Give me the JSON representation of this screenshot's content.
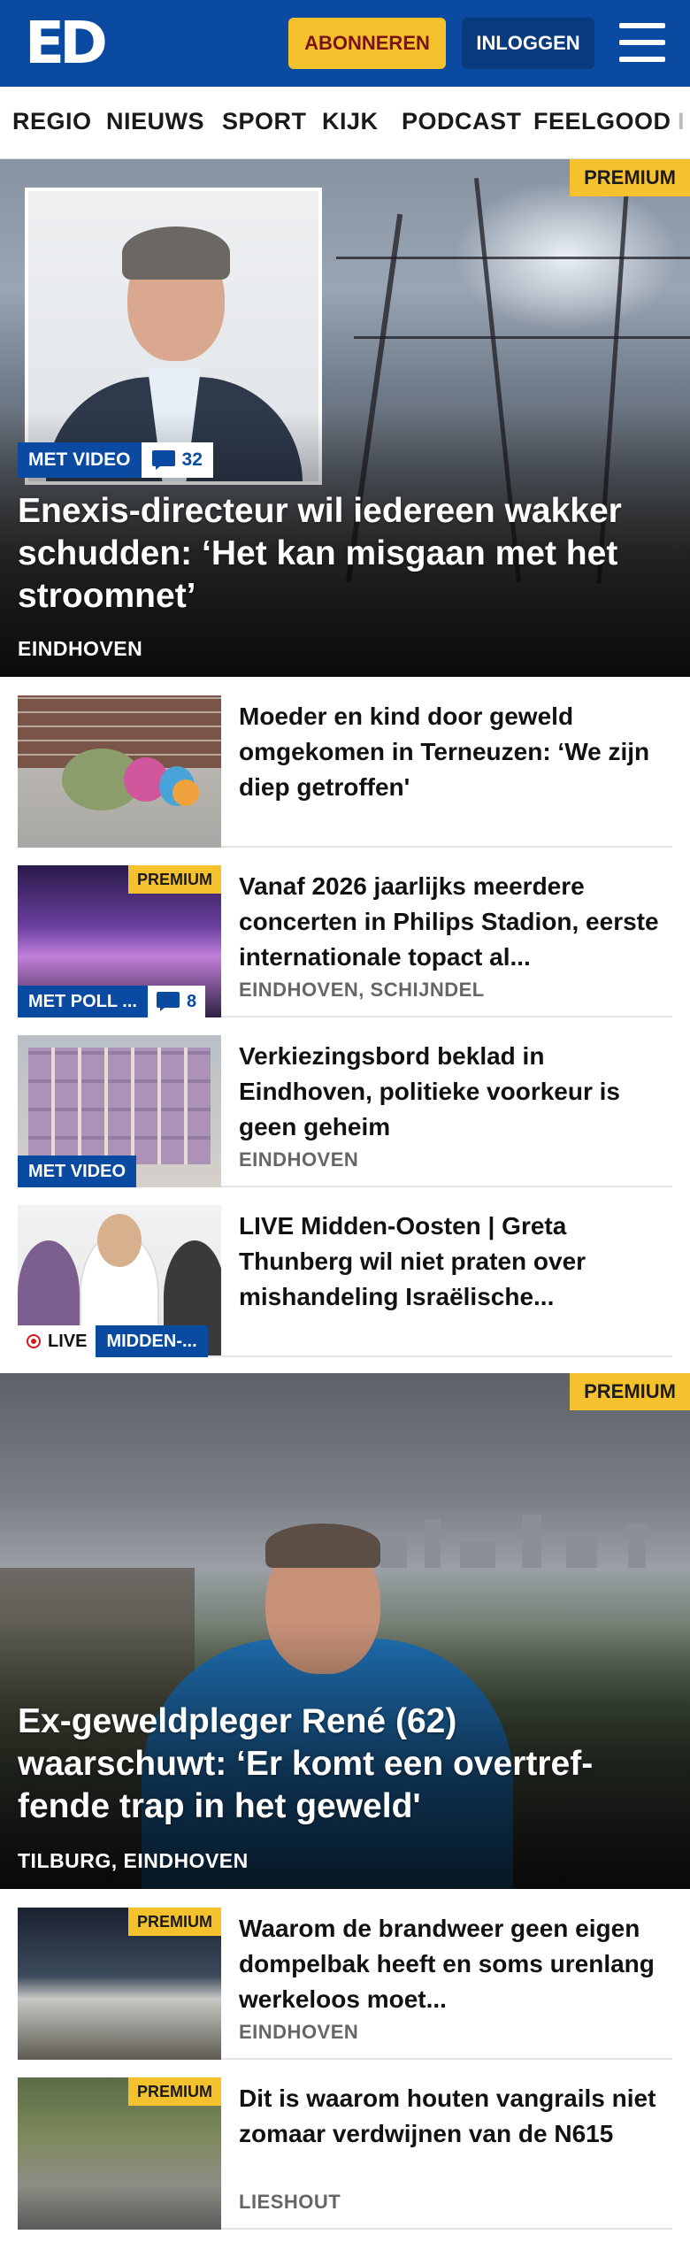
{
  "header": {
    "logo_text": "ED",
    "subscribe_label": "ABONNEREN",
    "login_label": "INLOGGEN",
    "brand_color": "#0a4ba1",
    "accent_color": "#f5c22e"
  },
  "nav": {
    "items": [
      "REGIO",
      "NIEUWS",
      "SPORT",
      "KIJK",
      "PODCAST",
      "FEELGOOD",
      "I"
    ]
  },
  "hero1": {
    "premium_label": "PREMIUM",
    "video_label": "MET VIDEO",
    "comment_count": "32",
    "title": "Enexis-directeur wil iedereen wakker schudden: ‘Het kan misgaan met het stroomnet’",
    "location": "EINDHOVEN"
  },
  "articles": [
    {
      "title": "Moeder en kind door geweld omgekomen in Terneuzen: ‘We zijn diep getroffen'",
      "location": ""
    },
    {
      "premium_label": "PREMIUM",
      "badge_label": "MET POLL ...",
      "comment_count": "8",
      "title": "Vanaf 2026 jaarlijks meerdere concerten in Philips Stadion, eerste internationale topact al...",
      "location": "EINDHOVEN, SCHIJNDEL"
    },
    {
      "badge_label": "MET VIDEO",
      "title": "Verkiezingsbord beklad in Eindhoven, politieke voorkeur is geen geheim",
      "location": "EINDHOVEN"
    },
    {
      "live_label": "LIVE",
      "badge_label": "MIDDEN-...",
      "title": "LIVE Midden-Oosten | Greta Thunberg wil niet praten over mishandeling Israëlische...",
      "location": ""
    }
  ],
  "hero2": {
    "premium_label": "PREMIUM",
    "title": "Ex-geweldpleger René (62) waarschuwt: ‘Er komt een overtref-fende trap in het geweld'",
    "location": "TILBURG, EINDHOVEN"
  },
  "articles2": [
    {
      "premium_label": "PREMIUM",
      "title": "Waarom de brandweer geen eigen dompelbak heeft en soms urenlang werkeloos moet...",
      "location": "EINDHOVEN"
    },
    {
      "premium_label": "PREMIUM",
      "title": "Dit is waarom houten vangrails niet zomaar verdwijnen van de N615",
      "location": "LIESHOUT"
    }
  ]
}
